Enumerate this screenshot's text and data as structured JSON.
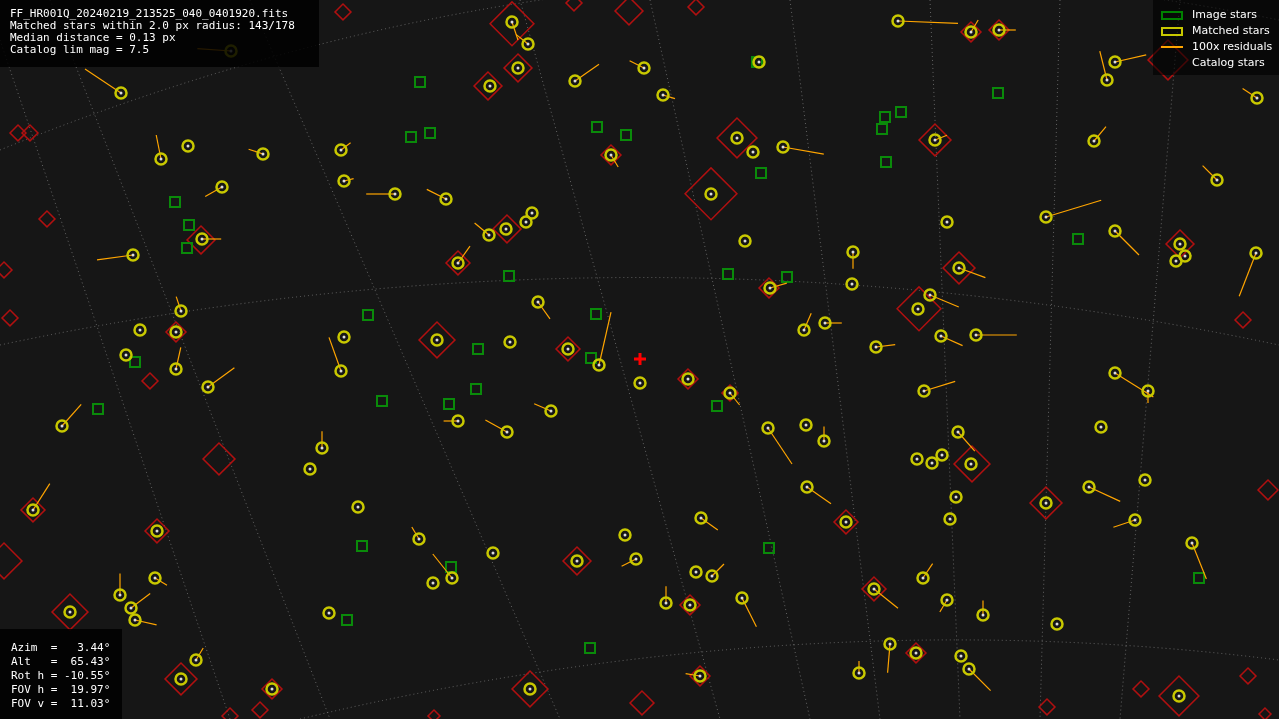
{
  "info_panel": {
    "lines": [
      "FF_HR001Q_20240219_213525_040_0401920.fits",
      "Matched stars within 2.0 px radius: 143/178",
      "Median distance = 0.13 px",
      "Catalog lim mag = 7.5"
    ]
  },
  "legend": [
    {
      "label": "Image stars",
      "kind": "box",
      "color": "#008000"
    },
    {
      "label": "Matched stars",
      "kind": "box",
      "color": "#c8c800"
    },
    {
      "label": "100x residuals",
      "kind": "line",
      "color": "#ffa500"
    },
    {
      "label": "Catalog stars",
      "kind": "none"
    }
  ],
  "pointing_panel": {
    "lines": [
      "Azim  =   3.44°",
      "Alt   =  65.43°",
      "Rot h = -10.55°",
      "FOV h =  19.97°",
      "FOV v =  11.03°"
    ]
  }
}
